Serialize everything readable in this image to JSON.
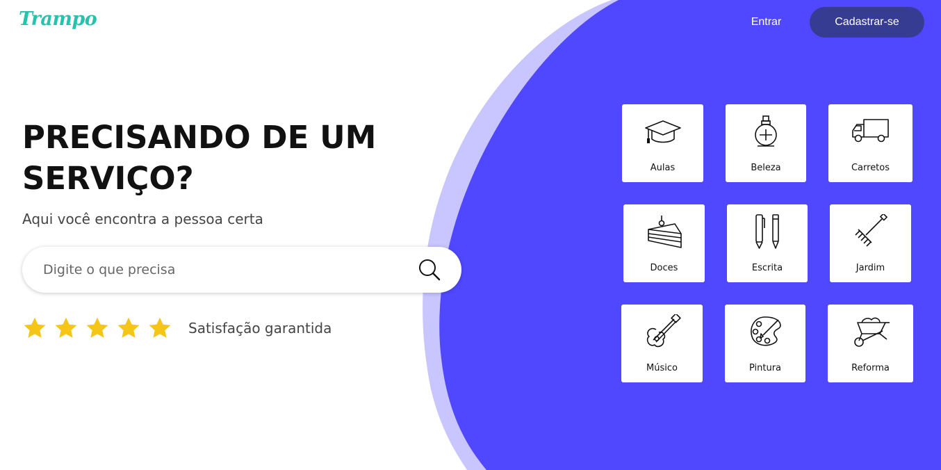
{
  "header": {
    "logo": "Trampo",
    "login_label": "Entrar",
    "signup_label": "Cadastrar-se"
  },
  "hero": {
    "title": "PRECISANDO DE UM SERVIÇO?",
    "subtitle": "Aqui você encontra a pessoa certa"
  },
  "search": {
    "placeholder": "Digite o que precisa",
    "value": ""
  },
  "rating": {
    "stars": 5,
    "max": 5,
    "label": "Satisfação garantida"
  },
  "categories": [
    {
      "label": "Aulas",
      "icon": "graduation-cap-icon"
    },
    {
      "label": "Beleza",
      "icon": "perfume-icon"
    },
    {
      "label": "Carretos",
      "icon": "truck-icon"
    },
    {
      "label": "Doces",
      "icon": "cake-icon"
    },
    {
      "label": "Escrita",
      "icon": "pen-pencil-icon"
    },
    {
      "label": "Jardim",
      "icon": "rake-icon"
    },
    {
      "label": "Músico",
      "icon": "guitar-icon"
    },
    {
      "label": "Pintura",
      "icon": "palette-icon"
    },
    {
      "label": "Reforma",
      "icon": "wheelbarrow-icon"
    }
  ],
  "colors": {
    "brand": "#27c2ad",
    "hero_panel": "#5048ff",
    "panel_edge": "#c8c5ff",
    "signup_button": "#363c92",
    "star": "#f5c518"
  }
}
